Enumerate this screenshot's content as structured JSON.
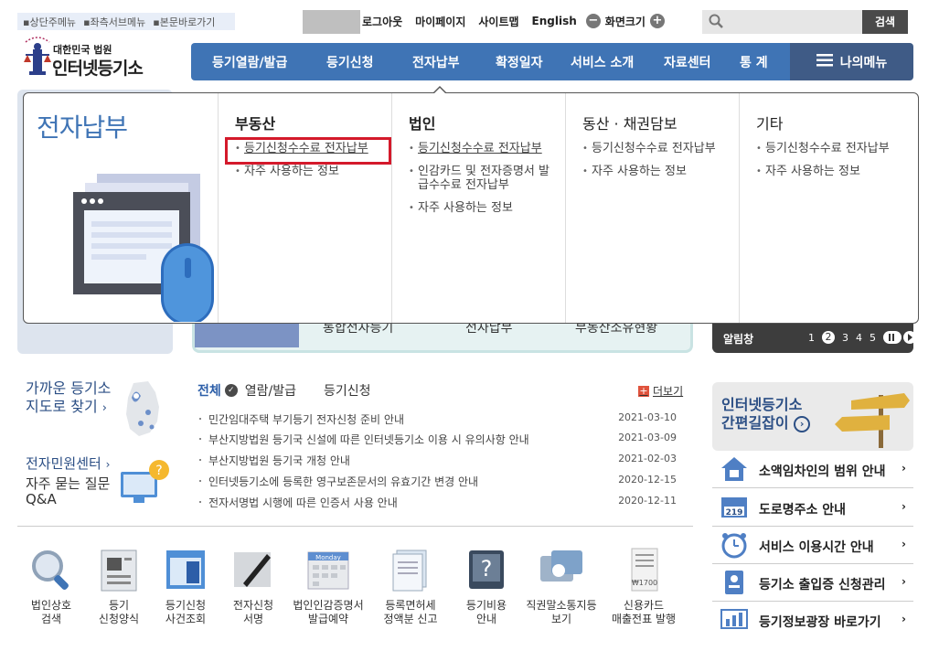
{
  "skip_links": [
    "▪상단주메뉴",
    "▪좌측서브메뉴",
    "▪본문바로가기"
  ],
  "logo": {
    "line1": "대한민국 법원",
    "line2": "인터넷등기소"
  },
  "util": {
    "logout": "로그아웃",
    "mypage": "마이페이지",
    "sitemap": "사이트맵",
    "english": "English",
    "zoom_label": "화면크기",
    "zoom_out": "−",
    "zoom_in": "+"
  },
  "search": {
    "button": "검색",
    "placeholder": ""
  },
  "gnb": [
    "등기열람/발급",
    "등기신청",
    "전자납부",
    "확정일자",
    "서비스 소개",
    "자료센터",
    "통 계"
  ],
  "my_menu": "나의메뉴",
  "dropdown": {
    "title": "전자납부",
    "columns": [
      {
        "heading": "부동산",
        "items": [
          "등기신청수수료 전자납부",
          "자주 사용하는 정보"
        ]
      },
      {
        "heading": "법인",
        "items": [
          "등기신청수수료 전자납부",
          "인감카드 및 전자증명서 발급수수료 전자납부",
          "자주 사용하는 정보"
        ]
      },
      {
        "heading": "동산 · 채권담보",
        "items": [
          "등기신청수수료 전자납부",
          "자주 사용하는 정보"
        ]
      },
      {
        "heading": "기타",
        "items": [
          "등기신청수수료 전자납부",
          "자주 사용하는 정보"
        ]
      }
    ]
  },
  "behind": {
    "mid": [
      "통합전자등기",
      "전자납부",
      "부동산소유현황"
    ],
    "notice_label": "알림창",
    "pages": [
      "1",
      "2",
      "3",
      "4",
      "5"
    ]
  },
  "left_links": {
    "near_1": "가까운 등기소",
    "near_2": "지도로 찾기",
    "civil": "전자민원센터",
    "faq_1": "자주 묻는 질문",
    "faq_2": "Q&A"
  },
  "notice_tabs": {
    "all": "전체",
    "t1": "열람/발급",
    "t2": "등기신청",
    "more": "더보기"
  },
  "notices": [
    {
      "title": "민간임대주택 부기등기 전자신청 준비 안내",
      "date": "2021-03-10"
    },
    {
      "title": "부산지방법원 등기국 신설에 따른 인터넷등기소 이용 시 유의사항 안내",
      "date": "2021-03-09"
    },
    {
      "title": "부산지방법원 등기국 개청 안내",
      "date": "2021-02-03"
    },
    {
      "title": "인터넷등기소에 등록한 영구보존문서의 유효기간 변경 안내",
      "date": "2020-12-15"
    },
    {
      "title": "전자서명법 시행에 따른 인증서 사용 안내",
      "date": "2020-12-11"
    }
  ],
  "quick": [
    {
      "l1": "법인상호",
      "l2": "검색"
    },
    {
      "l1": "등기",
      "l2": "신청양식"
    },
    {
      "l1": "등기신청",
      "l2": "사건조회"
    },
    {
      "l1": "전자신청",
      "l2": "서명"
    },
    {
      "l1": "법인인감증명서",
      "l2": "발급예약"
    },
    {
      "l1": "등록면허세",
      "l2": "정액분 신고"
    },
    {
      "l1": "등기비용",
      "l2": "안내"
    },
    {
      "l1": "직권말소통지등",
      "l2": "보기"
    },
    {
      "l1": "신용카드",
      "l2": "매출전표 발행"
    }
  ],
  "quick_icon_texts": {
    "calendar": "Monday",
    "receipt": "₩1700",
    "road": "219"
  },
  "guide": {
    "l1": "인터넷등기소",
    "l2": "간편길잡이"
  },
  "right_links": [
    "소액임차인의 범위 안내",
    "도로명주소 안내",
    "서비스 이용시간 안내",
    "등기소 출입증 신청관리",
    "등기정보광장 바로가기"
  ]
}
